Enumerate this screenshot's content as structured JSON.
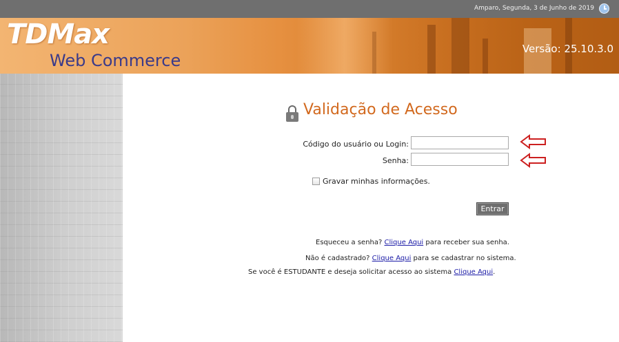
{
  "topbar": {
    "date_text": "Amparo, Segunda, 3 de Junho de 2019",
    "clock_icon": "clock-icon"
  },
  "header": {
    "logo_main": "TDMax",
    "logo_sub": "Web Commerce",
    "version": "Versão: 25.10.3.0"
  },
  "login": {
    "title": "Validação de Acesso",
    "lock_icon": "lock-icon",
    "login_label": "Código do usuário ou Login:",
    "login_value": "",
    "password_label": "Senha:",
    "password_value": "",
    "remember_label": "Gravar minhas informações.",
    "remember_checked": false,
    "submit_label": "Entrar",
    "arrow_color": "#cc1f1f"
  },
  "help": {
    "forgot_prefix": "Esqueceu a senha?",
    "forgot_link": "Clique Aqui",
    "forgot_suffix": "para receber sua senha.",
    "register_prefix": "Não é cadastrado?",
    "register_link": "Clique Aqui",
    "register_suffix": "para se cadastrar no sistema.",
    "student_prefix": "Se você é ESTUDANTE e deseja solicitar acesso ao sistema",
    "student_link": "Clique Aqui",
    "student_suffix": "."
  },
  "colors": {
    "title": "#d2691e",
    "link": "#1a1aa6",
    "topbar": "#6f6f6f",
    "button": "#6e6e6e"
  }
}
